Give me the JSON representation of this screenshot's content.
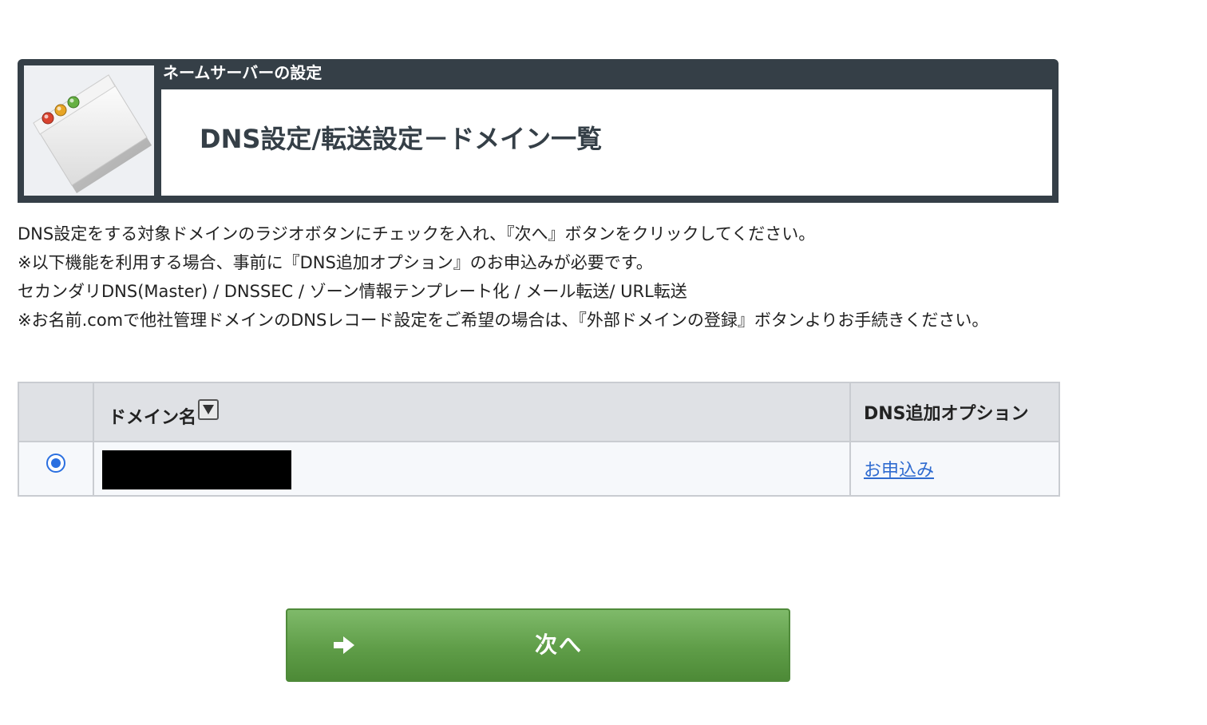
{
  "header": {
    "section_label": "ネームサーバーの設定",
    "page_title": "DNS設定/転送設定－ドメイン一覧",
    "icon": "browser-window-icon"
  },
  "instructions": {
    "lines": [
      "DNS設定をする対象ドメインのラジオボタンにチェックを入れ、『次へ』ボタンをクリックしてください。",
      "※以下機能を利用する場合、事前に『DNS追加オプション』のお申込みが必要です。",
      "セカンダリDNS(Master) / DNSSEC / ゾーン情報テンプレート化 / メール転送/ URL転送",
      "※お名前.comで他社管理ドメインのDNSレコード設定をご希望の場合は、『外部ドメインの登録』ボタンよりお手続きください。"
    ]
  },
  "table": {
    "columns": {
      "domain": "ドメイン名",
      "dns_option": "DNS追加オプション"
    },
    "sort_icon": "sort-down-icon",
    "rows": [
      {
        "selected": true,
        "domain_redacted": true,
        "option_link": "お申込み"
      }
    ]
  },
  "next_button": {
    "label": "次へ",
    "icon": "arrow-right-icon"
  },
  "colors": {
    "header_bg": "#353f47",
    "table_header_bg": "#dfe1e5",
    "link": "#2f6bd0",
    "radio": "#2a6fe0",
    "button_green": "#5f9d48"
  }
}
